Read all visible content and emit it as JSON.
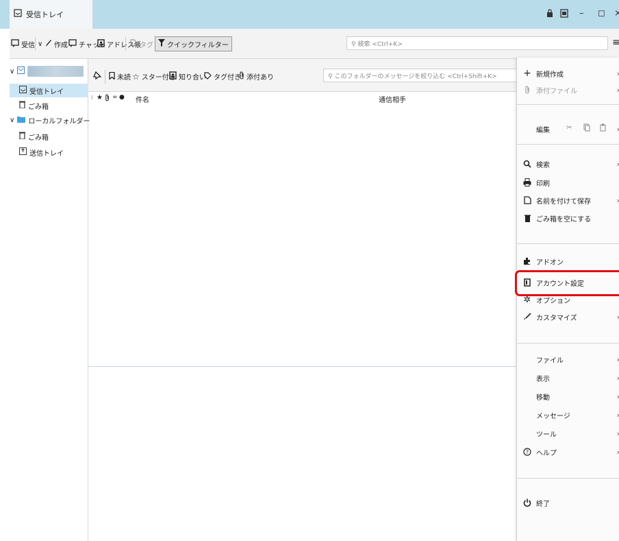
{
  "titlebar": {
    "tab_label": "受信トレイ",
    "controls": {
      "min": "–",
      "max": "◻"
    }
  },
  "toolbar": {
    "get_label": "受信",
    "write_label": "作成",
    "chat_label": "チャット",
    "address_label": "アドレス帳",
    "tag_label": "タグ",
    "quickfilter_label": "クイックフィルター",
    "search_placeholder": "検索 <Ctrl+K>",
    "menu_glyph": "≡"
  },
  "folders": {
    "inbox": "受信トレイ",
    "trash": "ごみ箱",
    "local": "ローカルフォルダー",
    "local_trash": "ごみ箱",
    "outbox": "送信トレイ"
  },
  "quickfilter": {
    "unread": "未読",
    "starred": "スター付き",
    "contacts": "知り合い",
    "tagged": "タグ付き",
    "attachment": "添付あり",
    "search_placeholder": "このフォルダーのメッセージを絞り込む <Ctrl+Shift+K>"
  },
  "thread_columns": {
    "subject": "件名",
    "correspondent": "通信相手"
  },
  "menu": {
    "new": "新規作成",
    "attachments": "添付ファイル",
    "edit": "編集",
    "find": "検索",
    "print": "印刷",
    "save_as": "名前を付けて保存",
    "empty_trash": "ごみ箱を空にする",
    "addons": "アドオン",
    "account_settings": "アカウント設定",
    "options": "オプション",
    "customize": "カスタマイズ",
    "file": "ファイル",
    "view": "表示",
    "go": "移動",
    "message": "メッセージ",
    "tools": "ツール",
    "help": "ヘルプ",
    "quit": "終了"
  },
  "colors": {
    "titlebar": "#b9dceb",
    "selection": "#cde6f5",
    "highlight_ring": "#e20f0f"
  }
}
